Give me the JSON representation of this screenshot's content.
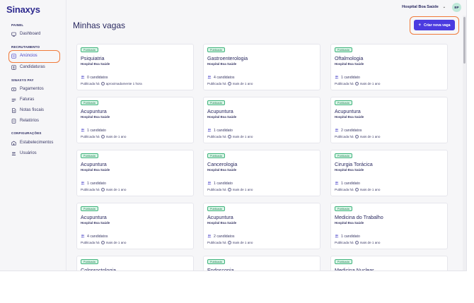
{
  "app": {
    "logo": "Sinaxys"
  },
  "header": {
    "org_name": "Hospital Boa Saúde",
    "avatar_initials": "BP"
  },
  "sidebar": {
    "sections": [
      {
        "label": "PAINEL",
        "items": [
          {
            "label": "Dashboard",
            "icon": "dashboard-icon"
          }
        ]
      },
      {
        "label": "RECRUTAMENTO",
        "items": [
          {
            "label": "Anúncios",
            "icon": "list-icon",
            "active": true
          },
          {
            "label": "Candidaturas",
            "icon": "person-icon"
          }
        ]
      },
      {
        "label": "SINAXYS PAY",
        "items": [
          {
            "label": "Pagamentos",
            "icon": "wallet-icon"
          },
          {
            "label": "Faturas",
            "icon": "invoice-icon"
          },
          {
            "label": "Notas fiscais",
            "icon": "document-icon"
          },
          {
            "label": "Relatórios",
            "icon": "report-icon"
          }
        ]
      },
      {
        "label": "CONFIGURAÇÕES",
        "items": [
          {
            "label": "Estabelecimentos",
            "icon": "building-icon"
          },
          {
            "label": "Usuários",
            "icon": "users-icon"
          }
        ]
      }
    ]
  },
  "main": {
    "title": "Minhas vagas",
    "create_button": "Criar nova vaga",
    "badge_label": "Publicada",
    "published_prefix": "Publicada há",
    "jobs": [
      {
        "title": "Psiquiatria",
        "hospital": "Hospital Boa Saúde",
        "candidates": "0 candidatos",
        "published": "aproximadamente 1 hora"
      },
      {
        "title": "Gastroenterologia",
        "hospital": "Hospital Boa Saúde",
        "candidates": "4 candidatos",
        "published": "mais de 1 ano"
      },
      {
        "title": "Oftalmologia",
        "hospital": "Hospital Boa Saúde",
        "candidates": "1 candidato",
        "published": "mais de 1 ano"
      },
      {
        "title": "Acupuntura",
        "hospital": "Hospital Boa Saúde",
        "candidates": "1 candidato",
        "published": "mais de 1 ano"
      },
      {
        "title": "Acupuntura",
        "hospital": "Hospital Boa Saúde",
        "candidates": "1 candidato",
        "published": "mais de 1 ano"
      },
      {
        "title": "Acupuntura",
        "hospital": "Hospital Boa Saúde",
        "candidates": "2 candidatos",
        "published": "mais de 1 ano"
      },
      {
        "title": "Acupuntura",
        "hospital": "Hospital Boa Saúde",
        "candidates": "1 candidato",
        "published": "mais de 1 ano"
      },
      {
        "title": "Cancerologia",
        "hospital": "Hospital Boa Saúde",
        "candidates": "1 candidato",
        "published": "mais de 1 ano"
      },
      {
        "title": "Cirurgia Torácica",
        "hospital": "Hospital Boa Saúde",
        "candidates": "1 candidato",
        "published": "mais de 1 ano"
      },
      {
        "title": "Acupuntura",
        "hospital": "Hospital Boa Saúde",
        "candidates": "4 candidatos",
        "published": "mais de 1 ano"
      },
      {
        "title": "Acupuntura",
        "hospital": "Hospital Boa Saúde",
        "candidates": "2 candidatos",
        "published": "mais de 1 ano"
      },
      {
        "title": "Medicina do Trabalho",
        "hospital": "Hospital Boa Saúde",
        "candidates": "1 candidato",
        "published": "mais de 1 ano"
      },
      {
        "title": "Coloproctologia"
      },
      {
        "title": "Endoscopia"
      },
      {
        "title": "Medicina Nuclear"
      }
    ]
  },
  "colors": {
    "accent": "#4b3be0",
    "highlight": "#f07a3a",
    "badge_bg": "#d8f5e6",
    "badge_border": "#3fb37c"
  }
}
